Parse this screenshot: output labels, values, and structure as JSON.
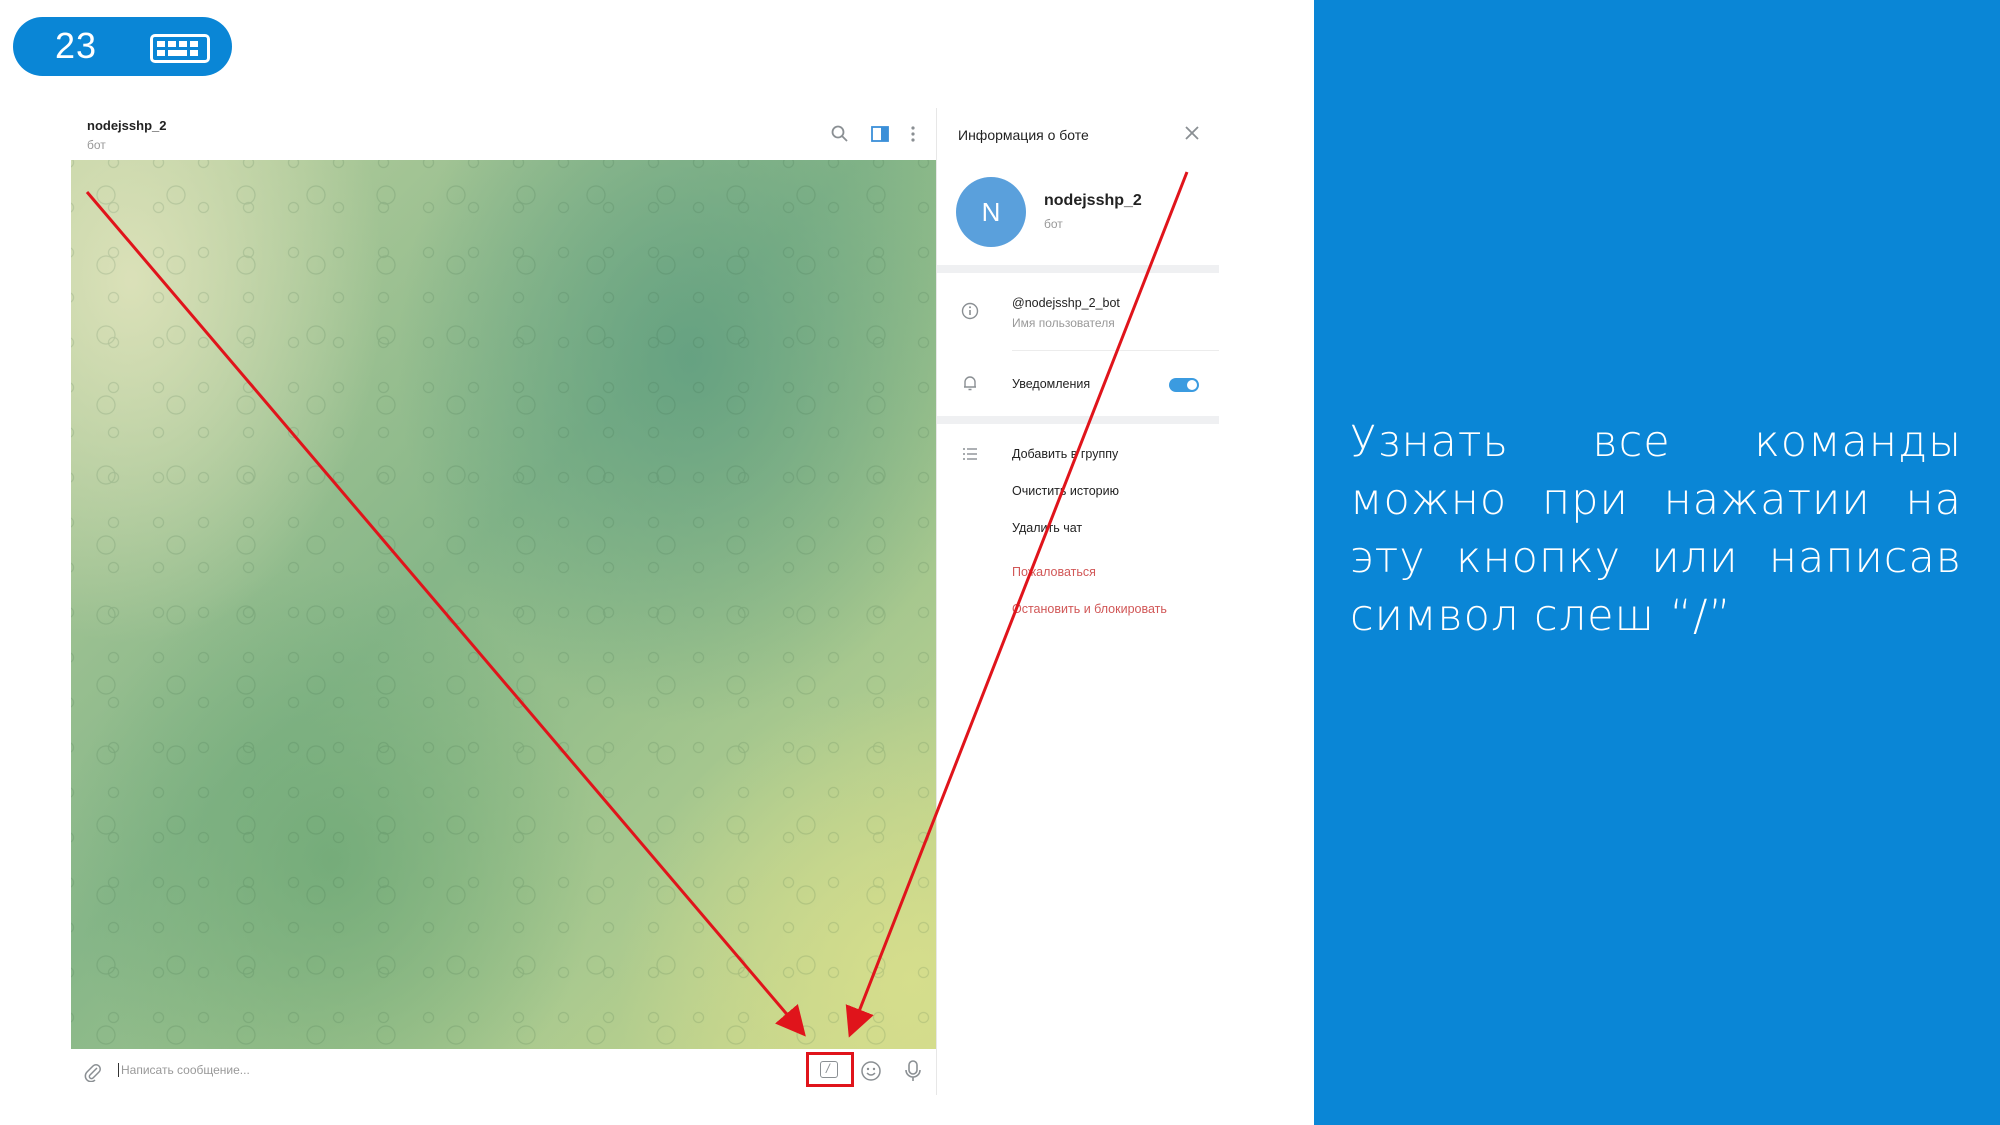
{
  "slide": {
    "number": "23"
  },
  "chat": {
    "title": "nodejsshp_2",
    "subtitle": "бот",
    "composer_placeholder": "Написать сообщение...",
    "command_button_symbol": "/"
  },
  "bot_info": {
    "panel_title": "Информация о боте",
    "avatar_letter": "N",
    "name": "nodejsshp_2",
    "subtitle": "бот",
    "username": "@nodejsshp_2_bot",
    "username_caption": "Имя пользователя",
    "notifications_label": "Уведомления",
    "notifications_on": true,
    "actions": [
      "Добавить в группу",
      "Очистить историю",
      "Удалить чат"
    ],
    "danger_actions": [
      "Пожаловаться",
      "Остановить и блокировать"
    ]
  },
  "side_note": {
    "text": "Узнать все команды можно при нажатии на эту кнопку или написав символ слеш “/”"
  },
  "colors": {
    "accent_blue": "#0a86d6",
    "annotation_red": "#e0141b",
    "danger_text": "#d15757",
    "toggle": "#3b9be0"
  }
}
